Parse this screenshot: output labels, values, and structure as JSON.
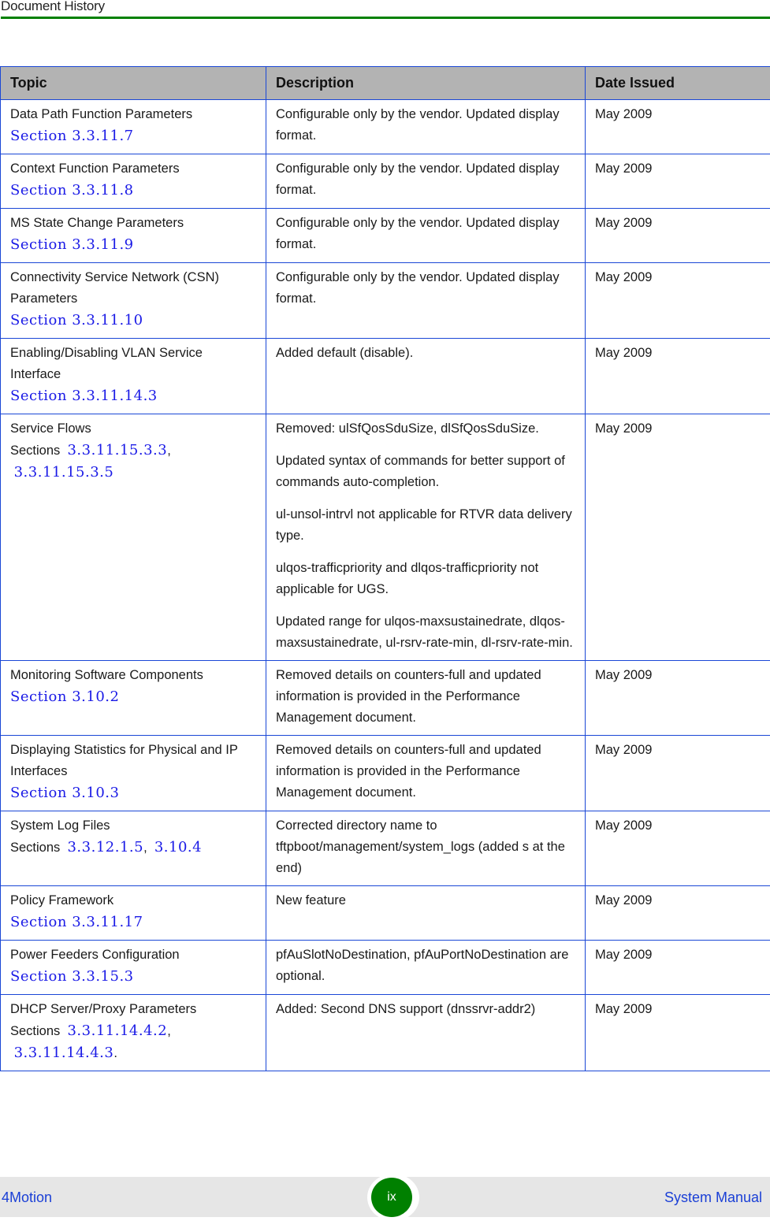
{
  "header": {
    "title": "Document History",
    "accent_color": "#008000"
  },
  "table": {
    "columns": [
      "Topic",
      "Description",
      "Date Issued"
    ],
    "rows": [
      {
        "topic": "Data Path Function Parameters",
        "prefix": "",
        "refs": [
          "Section 3.3.11.7"
        ],
        "description": [
          "Configurable only by the vendor. Updated display format."
        ],
        "date": "May 2009"
      },
      {
        "topic": "Context Function Parameters",
        "prefix": "",
        "refs": [
          "Section 3.3.11.8"
        ],
        "description": [
          "Configurable only by the vendor. Updated display format."
        ],
        "date": "May 2009"
      },
      {
        "topic": "MS State Change Parameters",
        "prefix": "",
        "refs": [
          "Section 3.3.11.9"
        ],
        "description": [
          "Configurable only by the vendor. Updated display format."
        ],
        "date": "May 2009"
      },
      {
        "topic": "Connectivity Service Network (CSN) Parameters",
        "prefix": "",
        "refs": [
          "Section 3.3.11.10"
        ],
        "description": [
          "Configurable only by the vendor. Updated display format."
        ],
        "date": "May 2009"
      },
      {
        "topic": "Enabling/Disabling VLAN Service Interface",
        "prefix": "",
        "refs": [
          "Section 3.3.11.14.3"
        ],
        "description": [
          "Added default (disable)."
        ],
        "date": "May 2009"
      },
      {
        "topic": "Service Flows",
        "prefix": "Sections",
        "refs": [
          "3.3.11.15.3.3",
          "3.3.11.15.3.5"
        ],
        "description": [
          "Removed: ulSfQosSduSize, dlSfQosSduSize.",
          "Updated syntax of commands for better support of commands auto-completion.",
          "ul-unsol-intrvl not applicable for RTVR data delivery type.",
          "ulqos-trafficpriority and dlqos-trafficpriority not applicable for UGS.",
          "Updated range for ulqos-maxsustainedrate, dlqos-maxsustainedrate, ul-rsrv-rate-min, dl-rsrv-rate-min."
        ],
        "date": "May 2009"
      },
      {
        "topic": "Monitoring Software Components",
        "prefix": "",
        "refs": [
          "Section 3.10.2"
        ],
        "description": [
          "Removed details on counters-full and updated information is provided in the Performance Management document."
        ],
        "date": "May 2009"
      },
      {
        "topic": "Displaying Statistics for Physical and IP Interfaces",
        "prefix": "",
        "refs": [
          "Section 3.10.3"
        ],
        "description": [
          "Removed details on counters-full and updated information is provided in the Performance Management document."
        ],
        "date": "May 2009"
      },
      {
        "topic": "System Log Files",
        "prefix": "Sections",
        "refs": [
          "3.3.12.1.5",
          "3.10.4"
        ],
        "description": [
          "Corrected directory name to tftpboot/management/system_logs (added s at the end)"
        ],
        "date": "May 2009"
      },
      {
        "topic": "Policy Framework",
        "prefix": "",
        "refs": [
          "Section 3.3.11.17"
        ],
        "description": [
          "New feature"
        ],
        "date": "May 2009"
      },
      {
        "topic": "Power Feeders Configuration",
        "prefix": "",
        "refs": [
          "Section 3.3.15.3"
        ],
        "description": [
          "pfAuSlotNoDestination, pfAuPortNoDestination are optional."
        ],
        "date": "May 2009"
      },
      {
        "topic": "DHCP Server/Proxy Parameters",
        "prefix": "Sections",
        "refs": [
          "3.3.11.14.4.2",
          "3.3.11.14.4.3"
        ],
        "description": [
          "Added: Second DNS support (dnssrvr-addr2)"
        ],
        "date": "May 2009",
        "trailing_period": true
      }
    ]
  },
  "footer": {
    "product": "4Motion",
    "page_number": "ix",
    "manual": "System Manual",
    "link_color": "#1a3fd6",
    "badge_color": "#008000"
  }
}
